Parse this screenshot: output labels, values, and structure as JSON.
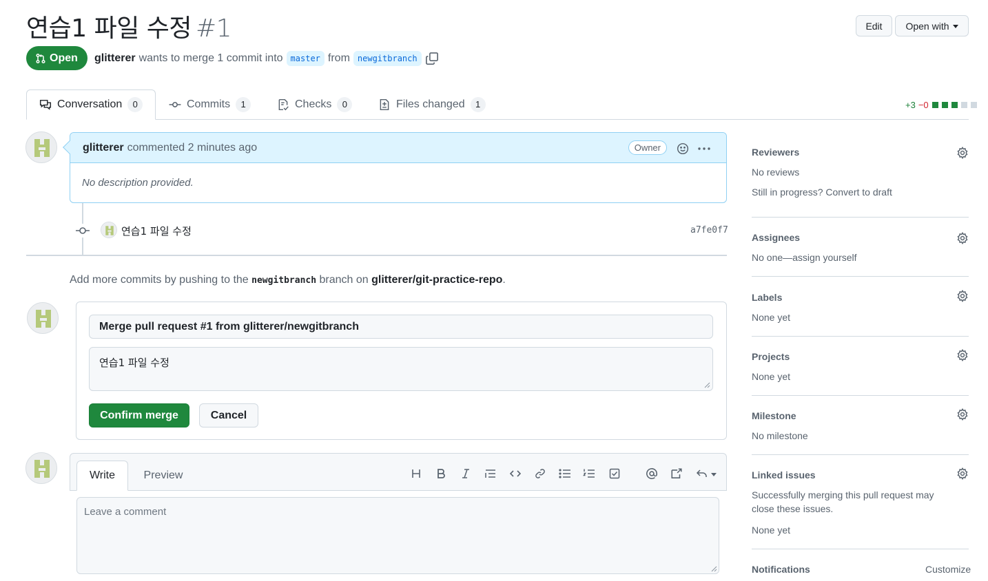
{
  "header": {
    "title": "연습1 파일 수정",
    "number": "#1",
    "edit_label": "Edit",
    "open_with_label": "Open with"
  },
  "status": {
    "state": "Open",
    "author": "glitterer",
    "text_wants": "wants to merge 1 commit into",
    "base_branch": "master",
    "text_from": "from",
    "head_branch": "newgitbranch"
  },
  "tabs": [
    {
      "label": "Conversation",
      "count": "0"
    },
    {
      "label": "Commits",
      "count": "1"
    },
    {
      "label": "Checks",
      "count": "0"
    },
    {
      "label": "Files changed",
      "count": "1"
    }
  ],
  "diffstat": {
    "additions": "+3",
    "deletions": "−0"
  },
  "comment": {
    "author": "glitterer",
    "action": "commented 2 minutes ago",
    "badge": "Owner",
    "body": "No description provided."
  },
  "commit": {
    "message": "연습1 파일 수정",
    "sha": "a7fe0f7"
  },
  "hint": {
    "prefix": "Add more commits by pushing to the",
    "branch": "newgitbranch",
    "middle": "branch on",
    "repo": "glitterer/git-practice-repo",
    "suffix": "."
  },
  "merge": {
    "title_value": "Merge pull request #1 from glitterer/newgitbranch",
    "body_value": "연습1 파일 수정",
    "confirm_label": "Confirm merge",
    "cancel_label": "Cancel"
  },
  "editor": {
    "write_tab": "Write",
    "preview_tab": "Preview",
    "placeholder": "Leave a comment"
  },
  "sidebar": {
    "reviewers": {
      "title": "Reviewers",
      "line1": "No reviews",
      "line2": "Still in progress? Convert to draft"
    },
    "assignees": {
      "title": "Assignees",
      "line1": "No one—assign yourself"
    },
    "labels": {
      "title": "Labels",
      "line1": "None yet"
    },
    "projects": {
      "title": "Projects",
      "line1": "None yet"
    },
    "milestone": {
      "title": "Milestone",
      "line1": "No milestone"
    },
    "linked_issues": {
      "title": "Linked issues",
      "line1": "Successfully merging this pull request may close these issues.",
      "line2": "None yet"
    },
    "notifications": {
      "title": "Notifications",
      "action": "Customize"
    }
  },
  "colors": {
    "green": "#1f883d",
    "accent_blue": "#0969da",
    "comment_header_bg": "#ddf4ff",
    "border": "#d1d9e0"
  }
}
